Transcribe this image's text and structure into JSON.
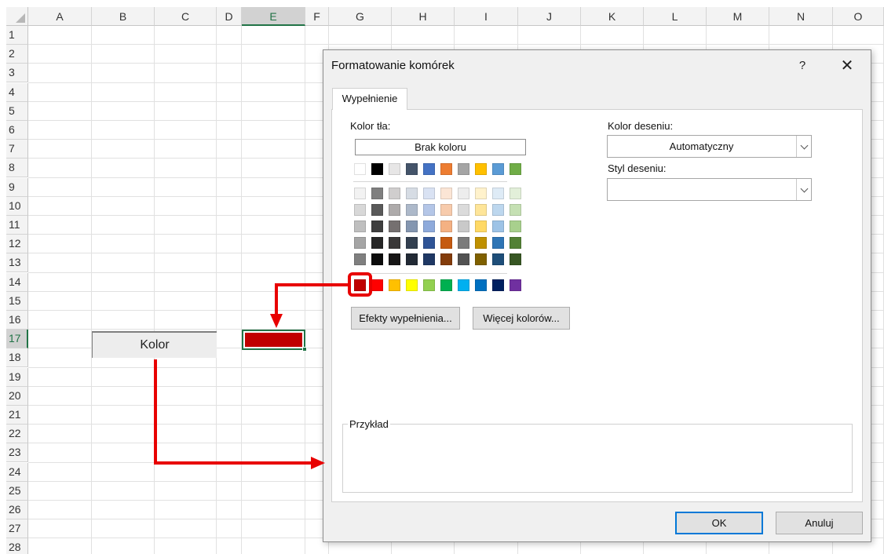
{
  "sheet": {
    "columns": [
      "A",
      "B",
      "C",
      "D",
      "E",
      "F",
      "G",
      "H",
      "I",
      "J",
      "K",
      "L",
      "M",
      "N",
      "O"
    ],
    "rows": [
      "1",
      "2",
      "3",
      "4",
      "5",
      "6",
      "7",
      "8",
      "9",
      "10",
      "11",
      "12",
      "13",
      "14",
      "15",
      "16",
      "17",
      "18",
      "19",
      "20",
      "21",
      "22",
      "23",
      "24",
      "25",
      "26",
      "27",
      "28"
    ],
    "selected_column": "E",
    "selected_row": "17",
    "cell_b17": "Kolor",
    "cell_e17_fill_color": "#c00000"
  },
  "dialog": {
    "title": "Formatowanie komórek",
    "help_label": "?",
    "close_label": "✕",
    "tab_label": "Wypełnienie",
    "background_color_label": "Kolor tła:",
    "no_color_label": "Brak koloru",
    "pattern_color_label": "Kolor deseniu:",
    "pattern_color_value": "Automatyczny",
    "pattern_style_label": "Styl deseniu:",
    "pattern_style_value": "",
    "fill_effects_label": "Efekty wypełnienia...",
    "more_colors_label": "Więcej kolorów...",
    "sample_label": "Przykład",
    "ok_label": "OK",
    "cancel_label": "Anuluj"
  },
  "palette": {
    "theme_row": [
      "#ffffff",
      "#000000",
      "#e7e6e6",
      "#44546a",
      "#4472c4",
      "#ed7d31",
      "#a5a5a5",
      "#ffc000",
      "#5b9bd5",
      "#70ad47"
    ],
    "tints": [
      [
        "#f2f2f2",
        "#7f7f7f",
        "#d0cece",
        "#d6dce4",
        "#d9e2f3",
        "#fbe5d5",
        "#ededed",
        "#fff2cc",
        "#deebf6",
        "#e2efd9"
      ],
      [
        "#d8d8d8",
        "#595959",
        "#aeabab",
        "#adb9ca",
        "#b4c6e7",
        "#f7cbac",
        "#dbdbdb",
        "#fee599",
        "#bdd7ee",
        "#c5e0b3"
      ],
      [
        "#bfbfbf",
        "#3f3f3f",
        "#757070",
        "#8496b0",
        "#8eaadb",
        "#f4b183",
        "#c9c9c9",
        "#ffd965",
        "#9dc3e6",
        "#a8d08d"
      ],
      [
        "#a5a5a5",
        "#262626",
        "#3a3838",
        "#323f4f",
        "#2f5496",
        "#c55a11",
        "#7b7b7b",
        "#bf9000",
        "#2e75b5",
        "#538135"
      ],
      [
        "#7f7f7f",
        "#0c0c0c",
        "#171616",
        "#222a35",
        "#1f3864",
        "#833c0b",
        "#525252",
        "#7f6000",
        "#1e4e79",
        "#375623"
      ]
    ],
    "standard_row": [
      "#c00000",
      "#ff0000",
      "#ffc000",
      "#ffff00",
      "#92d050",
      "#00b050",
      "#00b0f0",
      "#0070c0",
      "#002060",
      "#7030a0"
    ],
    "selected_color": "#c00000"
  }
}
